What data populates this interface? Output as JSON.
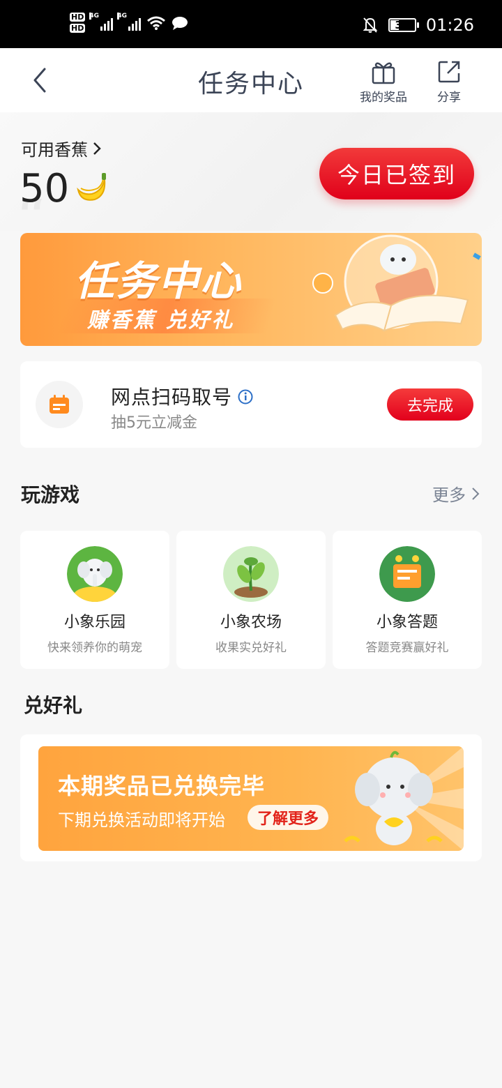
{
  "status_bar": {
    "time": "01:26",
    "battery": "35",
    "hd1": "HD",
    "hd2": "HD",
    "net1": "4G",
    "net2": "4G"
  },
  "header": {
    "title": "任务中心",
    "my_prizes_label": "我的奖品",
    "share_label": "分享"
  },
  "balance": {
    "label": "可用香蕉",
    "value": "50"
  },
  "checkin_button": "今日已签到",
  "banner": {
    "title": "任务中心",
    "subtitle": "赚香蕉 兑好礼"
  },
  "task": {
    "title": "网点扫码取号",
    "subtitle": "抽5元立减金",
    "button": "去完成"
  },
  "games_section": {
    "title": "玩游戏",
    "more": "更多",
    "items": [
      {
        "name": "小象乐园",
        "desc": "快来领养你的萌宠"
      },
      {
        "name": "小象农场",
        "desc": "收果实兑好礼"
      },
      {
        "name": "小象答题",
        "desc": "答题竞赛赢好礼"
      }
    ]
  },
  "exchange_section": {
    "title": "兑好礼",
    "banner_title": "本期奖品已兑换完毕",
    "banner_sub": "下期兑换活动即将开始",
    "learn_more": "了解更多"
  },
  "colors": {
    "primary_red": "#e2001c",
    "banner_orange": "#ff9a3c",
    "text_dark": "#222222",
    "text_muted": "#888888"
  }
}
